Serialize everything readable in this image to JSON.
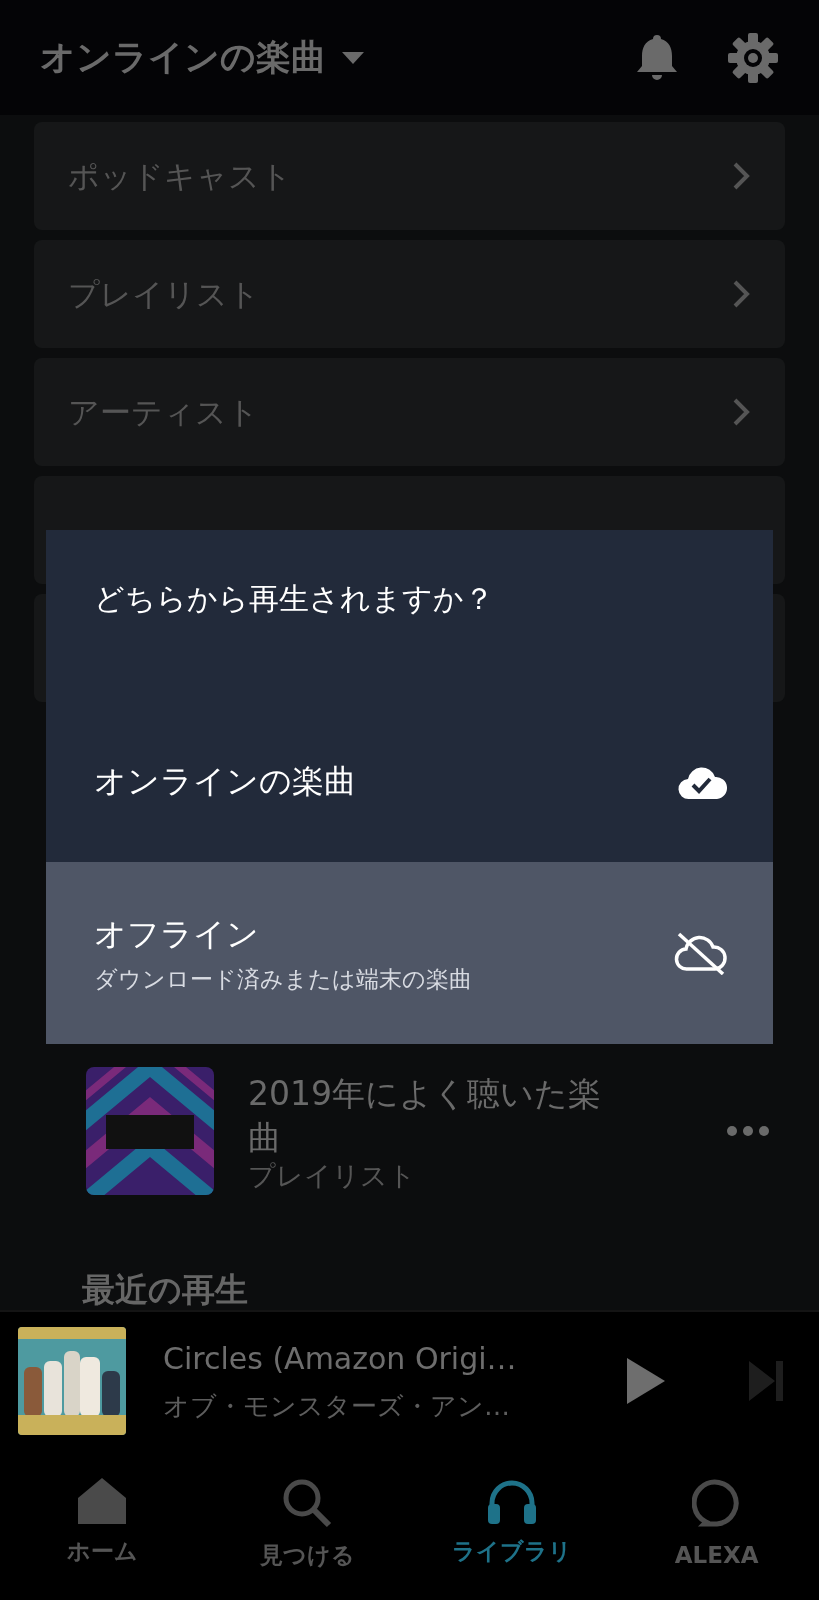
{
  "header": {
    "title": "オンラインの楽曲"
  },
  "menu": [
    {
      "label": "ポッドキャスト"
    },
    {
      "label": "プレイリスト"
    },
    {
      "label": "アーティスト"
    }
  ],
  "playlist": {
    "title": "2019年によく聴いた楽曲",
    "subtitle": "プレイリスト"
  },
  "section_title": "最近の再生",
  "dialog": {
    "title": "どちらから再生されますか？",
    "options": [
      {
        "kind": "online",
        "label": "オンラインの楽曲",
        "selected": false
      },
      {
        "kind": "offline",
        "label": "オフライン",
        "sublabel": "ダウンロード済みまたは端末の楽曲",
        "selected": true
      }
    ]
  },
  "now_playing": {
    "title": "Circles (Amazon Origi…",
    "artist": "オブ・モンスターズ・アン…"
  },
  "nav": [
    {
      "kind": "home",
      "label": "ホーム",
      "selected": false
    },
    {
      "kind": "search",
      "label": "見つける",
      "selected": false
    },
    {
      "kind": "library",
      "label": "ライブラリ",
      "selected": true
    },
    {
      "kind": "alexa",
      "label": "ALEXA",
      "selected": false
    }
  ]
}
